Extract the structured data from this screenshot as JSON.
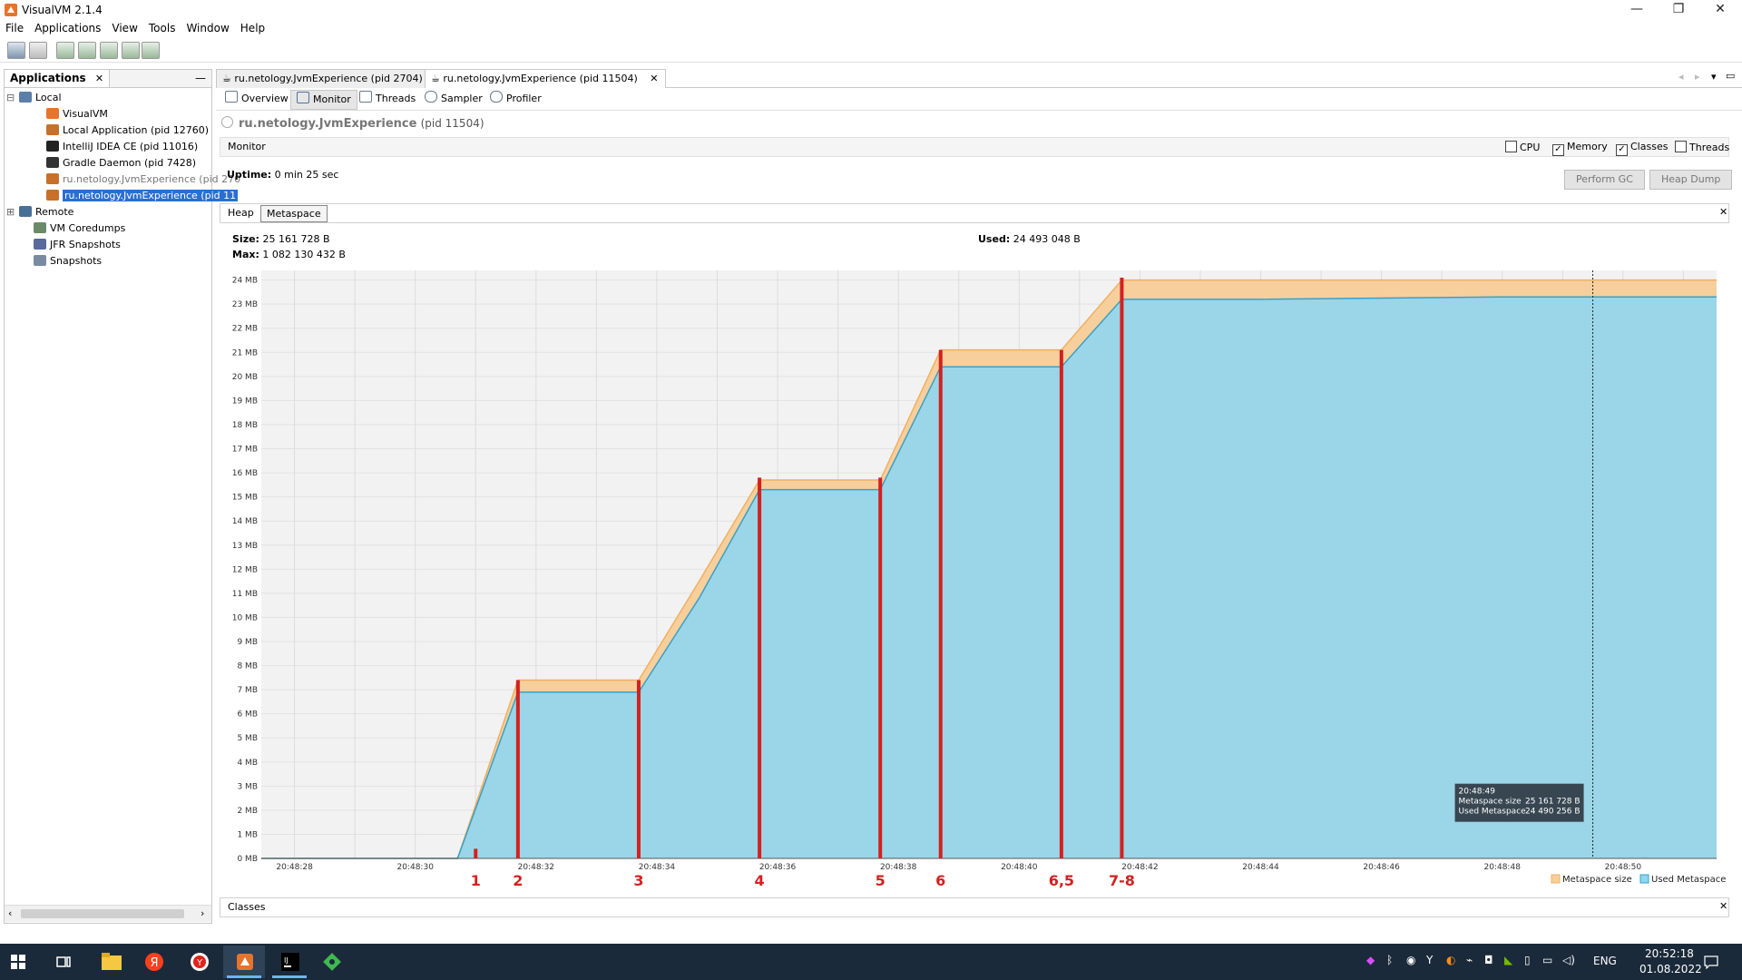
{
  "window": {
    "title": "VisualVM 2.1.4",
    "controls": {
      "minimize": "—",
      "restore": "❐",
      "close": "✕"
    }
  },
  "menubar": {
    "items": [
      "File",
      "Applications",
      "View",
      "Tools",
      "Window",
      "Help"
    ]
  },
  "applications_panel": {
    "tab_label": "Applications",
    "close": "✕",
    "minimize": "—",
    "tree": [
      {
        "label": "Local",
        "level": 0,
        "icon": "computer-icon",
        "expander": "⊟"
      },
      {
        "label": "VisualVM",
        "level": 2,
        "icon": "visualvm-icon"
      },
      {
        "label": "Local Application (pid 12760)",
        "level": 2,
        "icon": "java-icon"
      },
      {
        "label": "IntelliJ IDEA CE (pid 11016)",
        "level": 2,
        "icon": "intellij-icon"
      },
      {
        "label": "Gradle Daemon (pid 7428)",
        "level": 2,
        "icon": "gradle-icon"
      },
      {
        "label": "ru.netology.JvmExperience (pid 270",
        "level": 2,
        "icon": "java-icon",
        "disabled": true
      },
      {
        "label": "ru.netology.JvmExperience (pid 11",
        "level": 2,
        "icon": "java-icon",
        "selected": true
      },
      {
        "label": "Remote",
        "level": 0,
        "icon": "network-icon",
        "expander": "⊞"
      },
      {
        "label": "VM Coredumps",
        "level": 1,
        "icon": "coredump-icon"
      },
      {
        "label": "JFR Snapshots",
        "level": 1,
        "icon": "jfr-icon"
      },
      {
        "label": "Snapshots",
        "level": 1,
        "icon": "snapshot-icon"
      }
    ]
  },
  "document_tabs": [
    {
      "label": "ru.netology.JvmExperience (pid 2704)",
      "active": false,
      "close": "✕"
    },
    {
      "label": "ru.netology.JvmExperience (pid 11504)",
      "active": true,
      "close": "✕"
    }
  ],
  "sub_tabs": [
    {
      "label": "Overview",
      "active": false
    },
    {
      "label": "Monitor",
      "active": true
    },
    {
      "label": "Threads",
      "active": false
    },
    {
      "label": "Sampler",
      "active": false
    },
    {
      "label": "Profiler",
      "active": false
    }
  ],
  "app_header": {
    "name": "ru.netology.JvmExperience",
    "pid": "(pid 11504)"
  },
  "monitor": {
    "section_label": "Monitor",
    "checkboxes": [
      {
        "label": "CPU",
        "checked": false
      },
      {
        "label": "Memory",
        "checked": true
      },
      {
        "label": "Classes",
        "checked": true
      },
      {
        "label": "Threads",
        "checked": false
      }
    ],
    "uptime_label": "Uptime:",
    "uptime_value": "0 min 25 sec",
    "perform_gc": "Perform GC",
    "heap_dump": "Heap Dump"
  },
  "memory_tabs": {
    "heap": "Heap",
    "metaspace": "Metaspace",
    "close": "✕"
  },
  "stats": {
    "size_label": "Size:",
    "size_value": "25 161 728 B",
    "max_label": "Max:",
    "max_value": "1 082 130 432 B",
    "used_label": "Used:",
    "used_value": "24 493 048 B"
  },
  "chart_data": {
    "type": "area",
    "xlabel": "",
    "ylabel": "",
    "x_unit": "seconds after 20:48:28",
    "x_ticks": [
      "20:48:28",
      "20:48:30",
      "20:48:32",
      "20:48:34",
      "20:48:36",
      "20:48:38",
      "20:48:40",
      "20:48:42",
      "20:48:44",
      "20:48:46",
      "20:48:48",
      "20:48:50"
    ],
    "y_ticks": [
      "0 MB",
      "1 MB",
      "2 MB",
      "3 MB",
      "4 MB",
      "5 MB",
      "6 MB",
      "7 MB",
      "8 MB",
      "9 MB",
      "10 MB",
      "11 MB",
      "12 MB",
      "13 MB",
      "14 MB",
      "15 MB",
      "16 MB",
      "17 MB",
      "18 MB",
      "19 MB",
      "20 MB",
      "21 MB",
      "22 MB",
      "23 MB",
      "24 MB"
    ],
    "ylim": [
      0,
      24.4
    ],
    "xlim": [
      -0.55,
      23.55
    ],
    "series": [
      {
        "name": "Metaspace size",
        "color": "#f0b060",
        "fill": "#f7cf9c",
        "points": [
          [
            -0.55,
            0
          ],
          [
            2.7,
            0
          ],
          [
            3.7,
            7.4
          ],
          [
            5.7,
            7.4
          ],
          [
            6.7,
            11.5
          ],
          [
            7.7,
            15.7
          ],
          [
            9.7,
            15.7
          ],
          [
            10.7,
            21.1
          ],
          [
            12.7,
            21.1
          ],
          [
            13.7,
            24.0
          ],
          [
            23.55,
            24.0
          ]
        ]
      },
      {
        "name": "Used Metaspace",
        "color": "#3aa0c8",
        "fill": "#8fd6f0",
        "points": [
          [
            -0.55,
            0
          ],
          [
            2.7,
            0
          ],
          [
            3.7,
            6.9
          ],
          [
            5.7,
            6.9
          ],
          [
            6.7,
            10.8
          ],
          [
            7.7,
            15.3
          ],
          [
            9.7,
            15.3
          ],
          [
            10.7,
            20.4
          ],
          [
            12.7,
            20.4
          ],
          [
            13.7,
            23.2
          ],
          [
            16,
            23.2
          ],
          [
            20,
            23.3
          ],
          [
            23.55,
            23.3
          ]
        ]
      }
    ],
    "markers": [
      {
        "label": "1",
        "x": 3.0,
        "top": 0.4
      },
      {
        "label": "2",
        "x": 3.7,
        "top": 7.4
      },
      {
        "label": "3",
        "x": 5.7,
        "top": 7.4
      },
      {
        "label": "4",
        "x": 7.7,
        "top": 15.8
      },
      {
        "label": "5",
        "x": 9.7,
        "top": 15.8
      },
      {
        "label": "6",
        "x": 10.7,
        "top": 21.1
      },
      {
        "label": "6,5",
        "x": 12.7,
        "top": 21.1
      },
      {
        "label": "7-8",
        "x": 13.7,
        "top": 24.1
      }
    ],
    "cursor_x": 21.5,
    "tooltip": {
      "time": "20:48:49",
      "rows": [
        [
          "Metaspace size",
          "25 161 728 B"
        ],
        [
          "Used Metaspace",
          "24 490 256 B"
        ]
      ]
    },
    "legend": [
      "Metaspace size",
      "Used Metaspace"
    ],
    "legend_position": "bottom-right",
    "grid": true
  },
  "classes_section": {
    "label": "Classes",
    "close": "✕"
  },
  "taskbar": {
    "apps": [
      "windows-start-icon",
      "task-view-icon",
      "file-explorer-icon",
      "yandex-icon",
      "yandex-browser-icon",
      "visualvm-icon",
      "intellij-icon",
      "git-icon"
    ],
    "language": "ENG",
    "time": "20:52:18",
    "date": "01.08.2022"
  }
}
